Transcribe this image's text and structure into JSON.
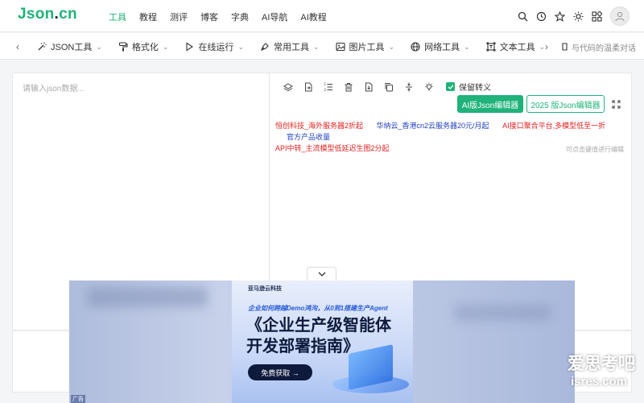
{
  "logo": {
    "part1": "Json",
    "dot": ".",
    "part2": "cn"
  },
  "nav": [
    {
      "label": "工具",
      "active": true
    },
    {
      "label": "教程"
    },
    {
      "label": "测评"
    },
    {
      "label": "博客"
    },
    {
      "label": "字典"
    },
    {
      "label": "AI导航"
    },
    {
      "label": "AI教程"
    }
  ],
  "toolbar": {
    "items": [
      {
        "label": "JSON工具",
        "icon": "magic-wand-icon"
      },
      {
        "label": "格式化",
        "icon": "paint-roller-icon"
      },
      {
        "label": "在线运行",
        "icon": "play-icon"
      },
      {
        "label": "常用工具",
        "icon": "pen-tool-icon"
      },
      {
        "label": "图片工具",
        "icon": "image-icon"
      },
      {
        "label": "网络工具",
        "icon": "globe-icon"
      },
      {
        "label": "文本工具",
        "icon": "text-frame-icon"
      }
    ],
    "slogan": "与代码的温柔对话"
  },
  "editor": {
    "placeholder": "请输入json数据...",
    "keep_escape_label": "保留转义",
    "btn_ai": "AI版Json编辑器",
    "btn_2025": "2025 版Json编辑器",
    "hint": "可点击键值进行编辑",
    "links": [
      {
        "text": "恒创科技_海外服务器2折起",
        "color": "#e02020"
      },
      {
        "text": "华纳云_香港cn2云服务器20元/月起",
        "color": "#1f3fbf"
      },
      {
        "text": "AI接口聚合平台,多模型低至一折",
        "color": "#e02020"
      },
      {
        "text": "官方产品收量",
        "color": "#1f3fbf"
      },
      {
        "text": "API中转_主流模型低延迟生图2分起",
        "color": "#e02020"
      }
    ]
  },
  "ad": {
    "brand": "亚马逊云科技",
    "subtitle": "企业如何跨越Demo鸿沟，从0到1搭建生产Agent",
    "title_line1": "《企业生产级智能体",
    "title_line2": "开发部署指南》",
    "button": "免费获取 →",
    "tag": "广告"
  },
  "watermark": {
    "line1": "爱思考吧",
    "line2": "isres.com"
  }
}
